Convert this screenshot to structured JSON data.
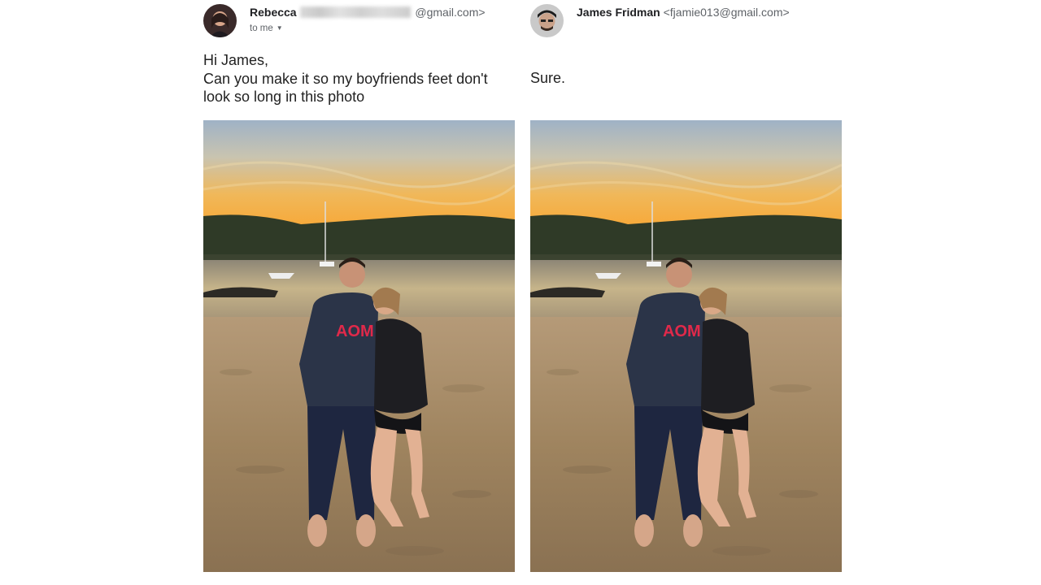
{
  "left_email": {
    "sender_name": "Rebecca",
    "sender_email_suffix": "@gmail.com>",
    "recipient_label": "to me",
    "body_lines": [
      "Hi James,",
      "Can you make it so my boyfriends feet don't",
      "look so long in this photo"
    ]
  },
  "right_email": {
    "sender_name": "James Fridman",
    "sender_email": "<fjamie013@gmail.com>",
    "body_lines": [
      "Sure."
    ]
  },
  "icons": {
    "dropdown": "chevron-down-icon"
  },
  "colors": {
    "name": "#202124",
    "meta": "#5f6368",
    "body": "#222222"
  }
}
